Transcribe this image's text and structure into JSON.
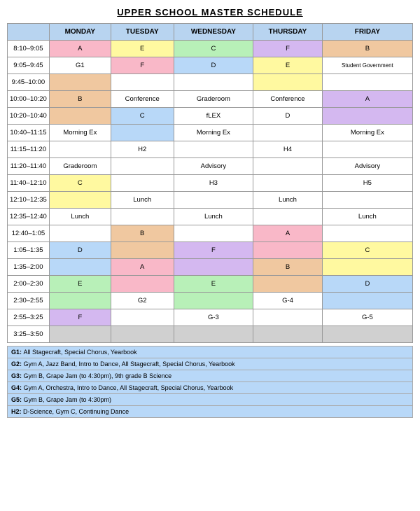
{
  "title": "UPPER SCHOOL MASTER SCHEDULE",
  "days": [
    "MONDAY",
    "TUESDAY",
    "WEDNESDAY",
    "THURSDAY",
    "FRIDAY"
  ],
  "rows": [
    {
      "time": "8:10–9:05",
      "cells": [
        {
          "text": "A",
          "color": "cell-pink"
        },
        {
          "text": "E",
          "color": "cell-yellow"
        },
        {
          "text": "C",
          "color": "cell-green"
        },
        {
          "text": "F",
          "color": "cell-purple"
        },
        {
          "text": "B",
          "color": "cell-orange"
        }
      ]
    },
    {
      "time": "9:05–9:45",
      "cells": [
        {
          "text": "G1",
          "color": "cell-white"
        },
        {
          "text": "F",
          "color": "cell-pink"
        },
        {
          "text": "D",
          "color": "cell-blue"
        },
        {
          "text": "E",
          "color": "cell-yellow"
        },
        {
          "text": "Student Government",
          "color": "cell-white"
        }
      ]
    },
    {
      "time": "9:45–10:00",
      "cells": [
        {
          "text": "",
          "color": "cell-orange"
        },
        {
          "text": "",
          "color": "cell-white"
        },
        {
          "text": "",
          "color": "cell-white"
        },
        {
          "text": "",
          "color": "cell-yellow"
        },
        {
          "text": "",
          "color": "cell-white"
        }
      ]
    },
    {
      "time": "10:00–10:20",
      "cells": [
        {
          "text": "B",
          "color": "cell-orange"
        },
        {
          "text": "Conference",
          "color": "cell-white"
        },
        {
          "text": "Graderoom",
          "color": "cell-white"
        },
        {
          "text": "Conference",
          "color": "cell-white"
        },
        {
          "text": "A",
          "color": "cell-purple"
        }
      ]
    },
    {
      "time": "10:20–10:40",
      "cells": [
        {
          "text": "",
          "color": "cell-orange"
        },
        {
          "text": "C",
          "color": "cell-blue"
        },
        {
          "text": "fLEX",
          "color": "cell-white"
        },
        {
          "text": "D",
          "color": "cell-white"
        },
        {
          "text": "",
          "color": "cell-purple"
        }
      ]
    },
    {
      "time": "10:40–11:15",
      "cells": [
        {
          "text": "Morning Ex",
          "color": "cell-white"
        },
        {
          "text": "",
          "color": "cell-blue"
        },
        {
          "text": "Morning Ex",
          "color": "cell-white"
        },
        {
          "text": "",
          "color": "cell-white"
        },
        {
          "text": "Morning Ex",
          "color": "cell-white"
        }
      ]
    },
    {
      "time": "11:15–11:20",
      "cells": [
        {
          "text": "",
          "color": "cell-white"
        },
        {
          "text": "H2",
          "color": "cell-white"
        },
        {
          "text": "",
          "color": "cell-white"
        },
        {
          "text": "H4",
          "color": "cell-white"
        },
        {
          "text": "",
          "color": "cell-white"
        }
      ]
    },
    {
      "time": "11:20–11:40",
      "cells": [
        {
          "text": "Graderoom",
          "color": "cell-white"
        },
        {
          "text": "",
          "color": "cell-white"
        },
        {
          "text": "Advisory",
          "color": "cell-white"
        },
        {
          "text": "",
          "color": "cell-white"
        },
        {
          "text": "Advisory",
          "color": "cell-white"
        }
      ]
    },
    {
      "time": "11:40–12:10",
      "cells": [
        {
          "text": "C",
          "color": "cell-yellow"
        },
        {
          "text": "",
          "color": "cell-white"
        },
        {
          "text": "H3",
          "color": "cell-white"
        },
        {
          "text": "",
          "color": "cell-white"
        },
        {
          "text": "H5",
          "color": "cell-white"
        }
      ]
    },
    {
      "time": "12:10–12:35",
      "cells": [
        {
          "text": "",
          "color": "cell-yellow"
        },
        {
          "text": "Lunch",
          "color": "cell-white"
        },
        {
          "text": "",
          "color": "cell-white"
        },
        {
          "text": "Lunch",
          "color": "cell-white"
        },
        {
          "text": "",
          "color": "cell-white"
        }
      ]
    },
    {
      "time": "12:35–12:40",
      "cells": [
        {
          "text": "Lunch",
          "color": "cell-white"
        },
        {
          "text": "",
          "color": "cell-white"
        },
        {
          "text": "Lunch",
          "color": "cell-white"
        },
        {
          "text": "",
          "color": "cell-white"
        },
        {
          "text": "Lunch",
          "color": "cell-white"
        }
      ]
    },
    {
      "time": "12:40–1:05",
      "cells": [
        {
          "text": "",
          "color": "cell-white"
        },
        {
          "text": "B",
          "color": "cell-orange"
        },
        {
          "text": "",
          "color": "cell-white"
        },
        {
          "text": "A",
          "color": "cell-pink"
        },
        {
          "text": "",
          "color": "cell-white"
        }
      ]
    },
    {
      "time": "1:05–1:35",
      "cells": [
        {
          "text": "D",
          "color": "cell-blue"
        },
        {
          "text": "",
          "color": "cell-orange"
        },
        {
          "text": "F",
          "color": "cell-purple"
        },
        {
          "text": "",
          "color": "cell-pink"
        },
        {
          "text": "C",
          "color": "cell-yellow"
        }
      ]
    },
    {
      "time": "1:35–2:00",
      "cells": [
        {
          "text": "",
          "color": "cell-blue"
        },
        {
          "text": "A",
          "color": "cell-pink"
        },
        {
          "text": "",
          "color": "cell-purple"
        },
        {
          "text": "B",
          "color": "cell-orange"
        },
        {
          "text": "",
          "color": "cell-yellow"
        }
      ]
    },
    {
      "time": "2:00–2:30",
      "cells": [
        {
          "text": "E",
          "color": "cell-green"
        },
        {
          "text": "",
          "color": "cell-pink"
        },
        {
          "text": "E",
          "color": "cell-green"
        },
        {
          "text": "",
          "color": "cell-orange"
        },
        {
          "text": "D",
          "color": "cell-blue"
        }
      ]
    },
    {
      "time": "2:30–2:55",
      "cells": [
        {
          "text": "",
          "color": "cell-green"
        },
        {
          "text": "G2",
          "color": "cell-white"
        },
        {
          "text": "",
          "color": "cell-green"
        },
        {
          "text": "G-4",
          "color": "cell-white"
        },
        {
          "text": "",
          "color": "cell-blue"
        }
      ]
    },
    {
      "time": "2:55–3:25",
      "cells": [
        {
          "text": "F",
          "color": "cell-purple"
        },
        {
          "text": "",
          "color": "cell-white"
        },
        {
          "text": "G-3",
          "color": "cell-white"
        },
        {
          "text": "",
          "color": "cell-white"
        },
        {
          "text": "G-5",
          "color": "cell-white"
        }
      ]
    },
    {
      "time": "3:25–3:50",
      "cells": [
        {
          "text": "",
          "color": "cell-gray"
        },
        {
          "text": "",
          "color": "cell-gray"
        },
        {
          "text": "",
          "color": "cell-gray"
        },
        {
          "text": "",
          "color": "cell-gray"
        },
        {
          "text": "",
          "color": "cell-gray"
        }
      ]
    }
  ],
  "legend": [
    {
      "label": "G1:",
      "desc": "All Stagecraft, Special Chorus, Yearbook"
    },
    {
      "label": "G2:",
      "desc": "Gym A, Jazz Band, Intro to Dance, All Stagecraft, Special Chorus, Yearbook"
    },
    {
      "label": "G3:",
      "desc": "Gym B, Grape Jam (to 4:30pm), 9th grade B Science"
    },
    {
      "label": "G4:",
      "desc": "Gym A, Orchestra, Intro to Dance, All Stagecraft, Special Chorus, Yearbook"
    },
    {
      "label": "G5:",
      "desc": "Gym B, Grape Jam (to 4:30pm)"
    },
    {
      "label": "H2:",
      "desc": "D-Science, Gym C, Continuing Dance"
    }
  ]
}
